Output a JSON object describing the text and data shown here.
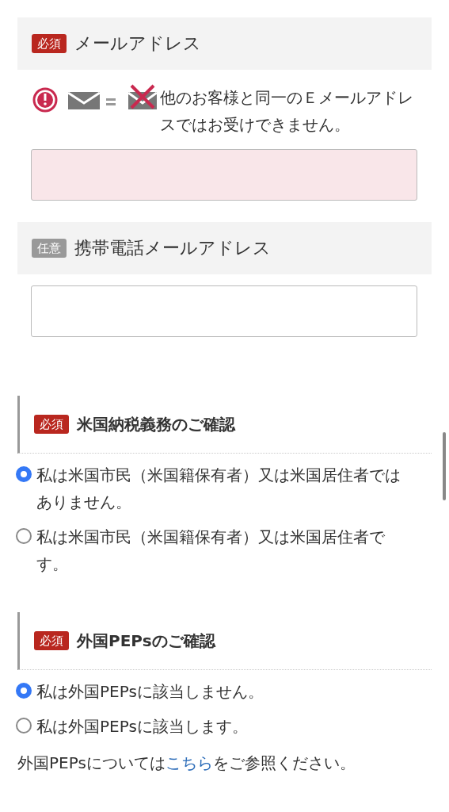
{
  "fields": [
    {
      "badge": {
        "kind": "required",
        "label": "必須"
      },
      "label": "メールアドレス",
      "note": "他のお客様と同一のＥメールアドレスではお受けできません。",
      "input": {
        "error": true
      }
    },
    {
      "badge": {
        "kind": "optional",
        "label": "任意"
      },
      "label": "携帯電話メールアドレス",
      "input": {
        "error": false
      }
    }
  ],
  "sections": [
    {
      "badge": {
        "kind": "required",
        "label": "必須"
      },
      "title": "米国納税義務のご確認",
      "options": [
        {
          "label": "私は米国市民（米国籍保有者）又は米国居住者ではありません。",
          "selected": true
        },
        {
          "label": "私は米国市民（米国籍保有者）又は米国居住者です。",
          "selected": false
        }
      ]
    },
    {
      "badge": {
        "kind": "required",
        "label": "必須"
      },
      "title": "外国PEPsのご確認",
      "options": [
        {
          "label": "私は外国PEPsに該当しません。",
          "selected": true
        },
        {
          "label": "私は外国PEPsに該当します。",
          "selected": false
        }
      ]
    }
  ],
  "footer": {
    "before": "外国PEPsについては",
    "link": "こちら",
    "after": "をご参照ください。"
  }
}
